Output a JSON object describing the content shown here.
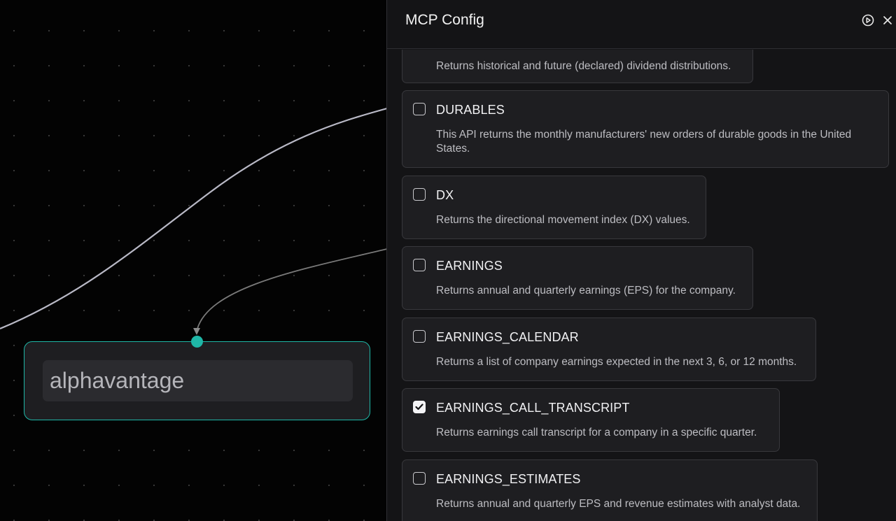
{
  "canvas": {
    "node": {
      "label": "alphavantage"
    }
  },
  "panel": {
    "title": "MCP Config",
    "icons": {
      "run": "play-circle-icon",
      "close": "close-icon"
    },
    "tools": [
      {
        "name": "",
        "description": "Returns historical and future (declared) dividend distributions.",
        "checked": false
      },
      {
        "name": "DURABLES",
        "description": "This API returns the monthly manufacturers' new orders of durable goods in the United States.",
        "checked": false
      },
      {
        "name": "DX",
        "description": "Returns the directional movement index (DX) values.",
        "checked": false
      },
      {
        "name": "EARNINGS",
        "description": "Returns annual and quarterly earnings (EPS) for the company.",
        "checked": false
      },
      {
        "name": "EARNINGS_CALENDAR",
        "description": "Returns a list of company earnings expected in the next 3, 6, or 12 months.",
        "checked": false
      },
      {
        "name": "EARNINGS_CALL_TRANSCRIPT",
        "description": "Returns earnings call transcript for a company in a specific quarter.",
        "checked": true
      },
      {
        "name": "EARNINGS_ESTIMATES",
        "description": "Returns annual and quarterly EPS and revenue estimates with analyst data.",
        "checked": false
      }
    ]
  }
}
